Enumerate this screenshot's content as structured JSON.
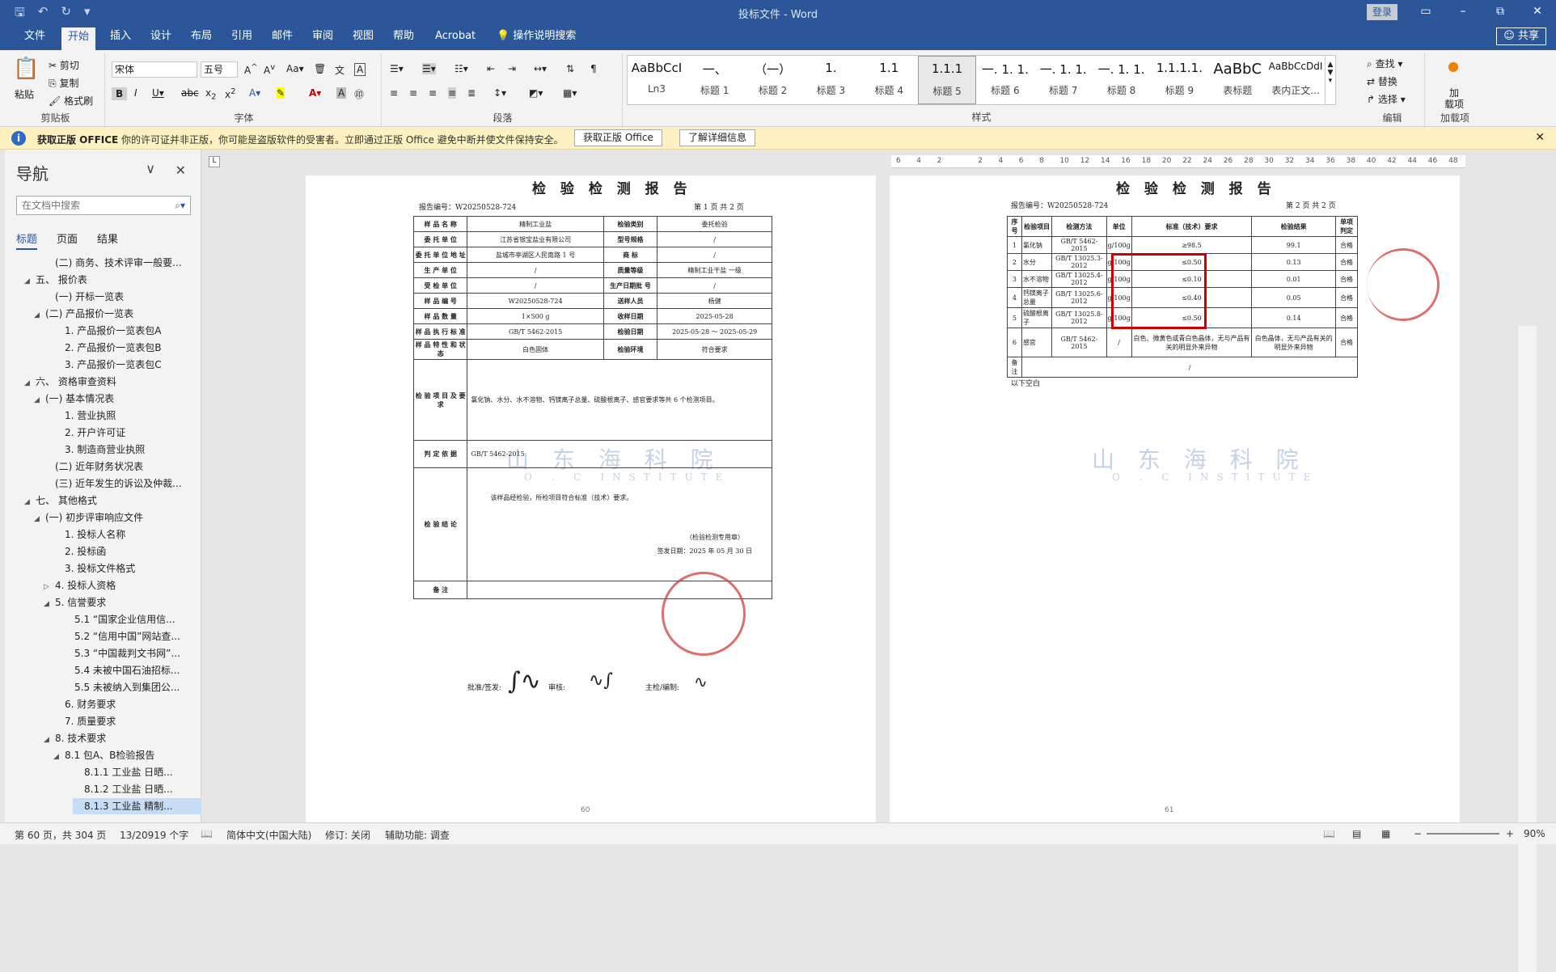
{
  "window": {
    "title": "投标文件 - Word",
    "login": "登录",
    "share": "共享"
  },
  "tabs": [
    "文件",
    "开始",
    "插入",
    "设计",
    "布局",
    "引用",
    "邮件",
    "审阅",
    "视图",
    "帮助",
    "Acrobat",
    "操作说明搜索"
  ],
  "ribbon": {
    "clipboard": {
      "paste": "粘贴",
      "cut": "剪切",
      "copy": "复制",
      "format_painter": "格式刷",
      "label": "剪贴板"
    },
    "font": {
      "name": "宋体",
      "size": "五号",
      "label": "字体"
    },
    "paragraph": {
      "label": "段落"
    },
    "styles": {
      "label": "样式",
      "items": [
        {
          "preview": "AaBbCcI",
          "name": "Ln3"
        },
        {
          "preview": "一、",
          "name": "标题 1"
        },
        {
          "preview": "（一）",
          "name": "标题 2"
        },
        {
          "preview": "1.",
          "name": "标题 3"
        },
        {
          "preview": "1.1",
          "name": "标题 4"
        },
        {
          "preview": "1.1.1",
          "name": "标题 5"
        },
        {
          "preview": "一. 1. 1.",
          "name": "标题 6"
        },
        {
          "preview": "一. 1. 1.",
          "name": "标题 7"
        },
        {
          "preview": "一. 1. 1.",
          "name": "标题 8"
        },
        {
          "preview": "1.1.1.1.",
          "name": "标题 9"
        },
        {
          "preview": "AaBbC",
          "name": "表标题"
        },
        {
          "preview": "AaBbCcDdI",
          "name": "表内正文..."
        }
      ]
    },
    "editing": {
      "find": "查找",
      "replace": "替换",
      "select": "选择",
      "label": "编辑"
    },
    "addins": {
      "label1": "加",
      "label2": "载项",
      "label": "加载项"
    }
  },
  "infobar": {
    "title": "获取正版 OFFICE",
    "text": "你的许可证并非正版，你可能是盗版软件的受害者。立即通过正版 Office 避免中断并使文件保持安全。",
    "btn1": "获取正版 Office",
    "btn2": "了解详细信息"
  },
  "nav": {
    "title": "导航",
    "search_placeholder": "在文档中搜索",
    "tabs": [
      "标题",
      "页面",
      "结果"
    ],
    "items": [
      {
        "text": "(二) 商务、技术评审一般要...",
        "indent": 3,
        "arrow": ""
      },
      {
        "text": "五、 报价表",
        "indent": 1,
        "arrow": "◢"
      },
      {
        "text": "(一) 开标一览表",
        "indent": 3,
        "arrow": ""
      },
      {
        "text": "(二) 产品报价一览表",
        "indent": 2,
        "arrow": "◢"
      },
      {
        "text": "1. 产品报价一览表包A",
        "indent": 4,
        "arrow": ""
      },
      {
        "text": "2. 产品报价一览表包B",
        "indent": 4,
        "arrow": ""
      },
      {
        "text": "3. 产品报价一览表包C",
        "indent": 4,
        "arrow": ""
      },
      {
        "text": "六、 资格审查资料",
        "indent": 1,
        "arrow": "◢"
      },
      {
        "text": "(一) 基本情况表",
        "indent": 2,
        "arrow": "◢"
      },
      {
        "text": "1. 营业执照",
        "indent": 4,
        "arrow": ""
      },
      {
        "text": "2. 开户许可证",
        "indent": 4,
        "arrow": ""
      },
      {
        "text": "3. 制造商营业执照",
        "indent": 4,
        "arrow": ""
      },
      {
        "text": "(二) 近年财务状况表",
        "indent": 3,
        "arrow": ""
      },
      {
        "text": "(三) 近年发生的诉讼及仲裁...",
        "indent": 3,
        "arrow": ""
      },
      {
        "text": "七、 其他格式",
        "indent": 1,
        "arrow": "◢"
      },
      {
        "text": "(一) 初步评审响应文件",
        "indent": 2,
        "arrow": "◢"
      },
      {
        "text": "1. 投标人名称",
        "indent": 4,
        "arrow": ""
      },
      {
        "text": "2. 投标函",
        "indent": 4,
        "arrow": ""
      },
      {
        "text": "3. 投标文件格式",
        "indent": 4,
        "arrow": ""
      },
      {
        "text": "4. 投标人资格",
        "indent": 3,
        "arrow": "▷"
      },
      {
        "text": "5. 信誉要求",
        "indent": 3,
        "arrow": "◢"
      },
      {
        "text": "5.1 “国家企业信用信...",
        "indent": 5,
        "arrow": ""
      },
      {
        "text": "5.2 “信用中国”网站查...",
        "indent": 5,
        "arrow": ""
      },
      {
        "text": "5.3 “中国裁判文书网”...",
        "indent": 5,
        "arrow": ""
      },
      {
        "text": "5.4 未被中国石油招标...",
        "indent": 5,
        "arrow": ""
      },
      {
        "text": "5.5 未被纳入到集团公...",
        "indent": 5,
        "arrow": ""
      },
      {
        "text": "6. 财务要求",
        "indent": 4,
        "arrow": ""
      },
      {
        "text": "7. 质量要求",
        "indent": 4,
        "arrow": ""
      },
      {
        "text": "8. 技术要求",
        "indent": 3,
        "arrow": "◢"
      },
      {
        "text": "8.1 包A、B检验报告",
        "indent": 4,
        "arrow": "◢"
      },
      {
        "text": "8.1.1 工业盐 日晒...",
        "indent": 6,
        "arrow": ""
      },
      {
        "text": "8.1.2 工业盐 日晒...",
        "indent": 6,
        "arrow": ""
      },
      {
        "text": "8.1.3 工业盐 精制...",
        "indent": 6,
        "arrow": "",
        "selected": true
      }
    ]
  },
  "page1": {
    "title": "检 验 检 测 报 告",
    "report_no": "报告编号：W20250528-724",
    "page_info": "第 1 页 共 2 页",
    "rows": [
      [
        "样 品 名 称",
        "精制工业盐",
        "检验类别",
        "委托检验"
      ],
      [
        "委 托 单 位",
        "江苏省银宝盐业有限公司",
        "型号规格",
        "/"
      ],
      [
        "委 托 单 位 地 址",
        "盐城市亭湖区人民南路 1 号",
        "商 标",
        "/"
      ],
      [
        "生 产 单 位",
        "/",
        "质量等级",
        "精制工业干盐 一级"
      ],
      [
        "受 检 单 位",
        "/",
        "生产日期批 号",
        "/"
      ],
      [
        "样 品 编 号",
        "W20250528-724",
        "送样人员",
        "杨健"
      ],
      [
        "样 品 数 量",
        "1×500 g",
        "收样日期",
        "2025-05-28"
      ],
      [
        "样 品 执 行 标 准",
        "GB/T 5462-2015",
        "检验日期",
        "2025-05-28 ～ 2025-05-29"
      ],
      [
        "样 品 特 性 和 状 态",
        "白色固体",
        "检验环境",
        "符合要求"
      ]
    ],
    "items_label": "检 验 项 目 及 要 求",
    "items_text": "氯化钠、水分、水不溶物、钙镁离子总量、硫酸根离子、感官要求等共 6 个检测项目。",
    "basis_label": "判 定 依 据",
    "basis": "GB/T 5462-2015",
    "conclusion_label": "检 验 结 论",
    "conclusion": "该样品经检验，所检项目符合标准（技术）要求。",
    "stamp_text": "（检验检测专用章）",
    "sign_date": "签发日期：2025 年 05 月 30 日",
    "remark_label": "备 注",
    "signers": {
      "approve": "批准/签发:",
      "review": "审核:",
      "main": "主检/编制:"
    },
    "watermark1": "山 东 海 科 院",
    "watermark2": "O . C   INSTITUTE",
    "page_number": "60"
  },
  "page2": {
    "title": "检 验 检 测 报 告",
    "report_no": "报告编号：W20250528-724",
    "page_info": "第 2 页 共 2 页",
    "headers": [
      "序号",
      "检验项目",
      "检测方法",
      "单位",
      "标准（技术）要求",
      "检验结果",
      "单项判定"
    ],
    "rows": [
      [
        "1",
        "氯化钠",
        "GB/T 5462-2015",
        "g/100g",
        "≥98.5",
        "99.1",
        "合格"
      ],
      [
        "2",
        "水分",
        "GB/T 13025.3-2012",
        "g/100g",
        "≤0.50",
        "0.13",
        "合格"
      ],
      [
        "3",
        "水不溶物",
        "GB/T 13025.4-2012",
        "g/100g",
        "≤0.10",
        "0.01",
        "合格"
      ],
      [
        "4",
        "钙镁离子总量",
        "GB/T 13025.6-2012",
        "g/100g",
        "≤0.40",
        "0.05",
        "合格"
      ],
      [
        "5",
        "硫酸根离子",
        "GB/T 13025.8-2012",
        "g/100g",
        "≤0.50",
        "0.14",
        "合格"
      ],
      [
        "6",
        "感官",
        "GB/T 5462-2015",
        "/",
        "白色、微黄色或青白色晶体，无与产品有关的明显外来异物",
        "白色晶体，无与产品有关的明显外来异物",
        "合格"
      ]
    ],
    "remark_label": "备 注",
    "remark": "/",
    "blank": "以下空白",
    "page_number": "61"
  },
  "ruler": [
    "6",
    "4",
    "2",
    "",
    "2",
    "4",
    "6",
    "8",
    "10",
    "12",
    "14",
    "16",
    "18",
    "20",
    "22",
    "24",
    "26",
    "28",
    "30",
    "32",
    "34",
    "36",
    "38",
    "40",
    "42",
    "44",
    "46",
    "48"
  ],
  "status": {
    "page": "第 60 页，共 304 页",
    "words": "13/20919 个字",
    "lang": "简体中文(中国大陆)",
    "track": "修订: 关闭",
    "access": "辅助功能: 调查",
    "zoom": "90%"
  }
}
